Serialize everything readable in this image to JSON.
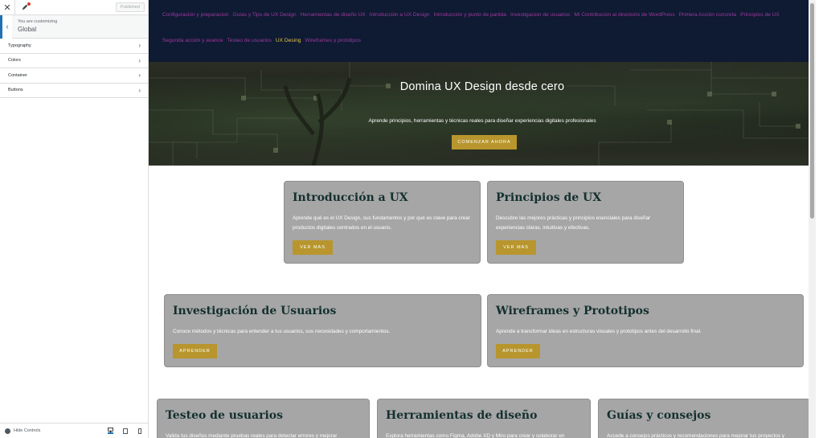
{
  "customizer": {
    "published_label": "Published",
    "customizing_label": "You are customizing",
    "section_title": "Global",
    "panels": [
      {
        "label": "Typography"
      },
      {
        "label": "Colors"
      },
      {
        "label": "Container"
      },
      {
        "label": "Buttons"
      }
    ],
    "hide_controls_label": "Hide Controls",
    "accent_color": "#2271b1"
  },
  "site": {
    "nav": [
      {
        "label": "Configuración y preparacion"
      },
      {
        "label": "Guías y Tips de UX Design"
      },
      {
        "label": "Herramientas de diseño UX"
      },
      {
        "label": "Introducción a UX Design"
      },
      {
        "label": "Introducción y punto de partida"
      },
      {
        "label": "Investigacion de usuarios"
      },
      {
        "label": "Mi Contribucion al directorio de WordPress"
      },
      {
        "label": "Primera Acción concreta"
      },
      {
        "label": "Principios de UX"
      },
      {
        "label": "Segunda acción y avance"
      },
      {
        "label": "Testeo de usuarios"
      },
      {
        "label": "UX Desing"
      },
      {
        "label": "Wireframes y prototipos"
      }
    ],
    "nav_current_index": 11,
    "hero": {
      "title": "Domina UX Design desde cero",
      "subtitle": "Aprende principios, herramientas y técnicas reales para diseñar experiencias digitales profesionales",
      "button": "COMENZAR AHORA"
    },
    "cards": [
      {
        "title": "Introducción a UX",
        "desc": "Aprende qué es el UX Design, sus fundamentos y por qué es clave para crear productos digitales centrados en el usuario.",
        "button": "VER MAS"
      },
      {
        "title": "Principios de UX",
        "desc": "Descubre las mejores prácticas y principios esenciales para diseñar experiencias claras, intuitivas y efectivas.",
        "button": "VER MAS"
      },
      {
        "title": "Investigación de Usuarios",
        "desc": "Conoce métodos y técnicas para entender a tus usuarios, sus necesidades y comportamientos.",
        "button": "APRENDER"
      },
      {
        "title": "Wireframes y Prototipos",
        "desc": "Aprende a transformar ideas en estructuras visuales y prototipos antes del desarrollo final.",
        "button": "APRENDER"
      },
      {
        "title": "Testeo de usuarios",
        "desc": "Valida tus diseños mediante pruebas reales para detectar errores y mejorar",
        "button": ""
      },
      {
        "title": "Herramientas de diseño",
        "desc": "Explora herramientas como Figma, Adobe XD y Miro para crear y colaborar en",
        "button": ""
      },
      {
        "title": "Guías y consejos",
        "desc": "Accede a consejos prácticos y recomendaciones para mejorar tus proyectos y",
        "button": ""
      }
    ],
    "colors": {
      "navbar": "#0f1a33",
      "nav_link": "#9b3a9b",
      "nav_current": "#e3c54a",
      "button": "#b8962d",
      "card": "#a6a6a6",
      "card_title": "#14302e"
    }
  }
}
